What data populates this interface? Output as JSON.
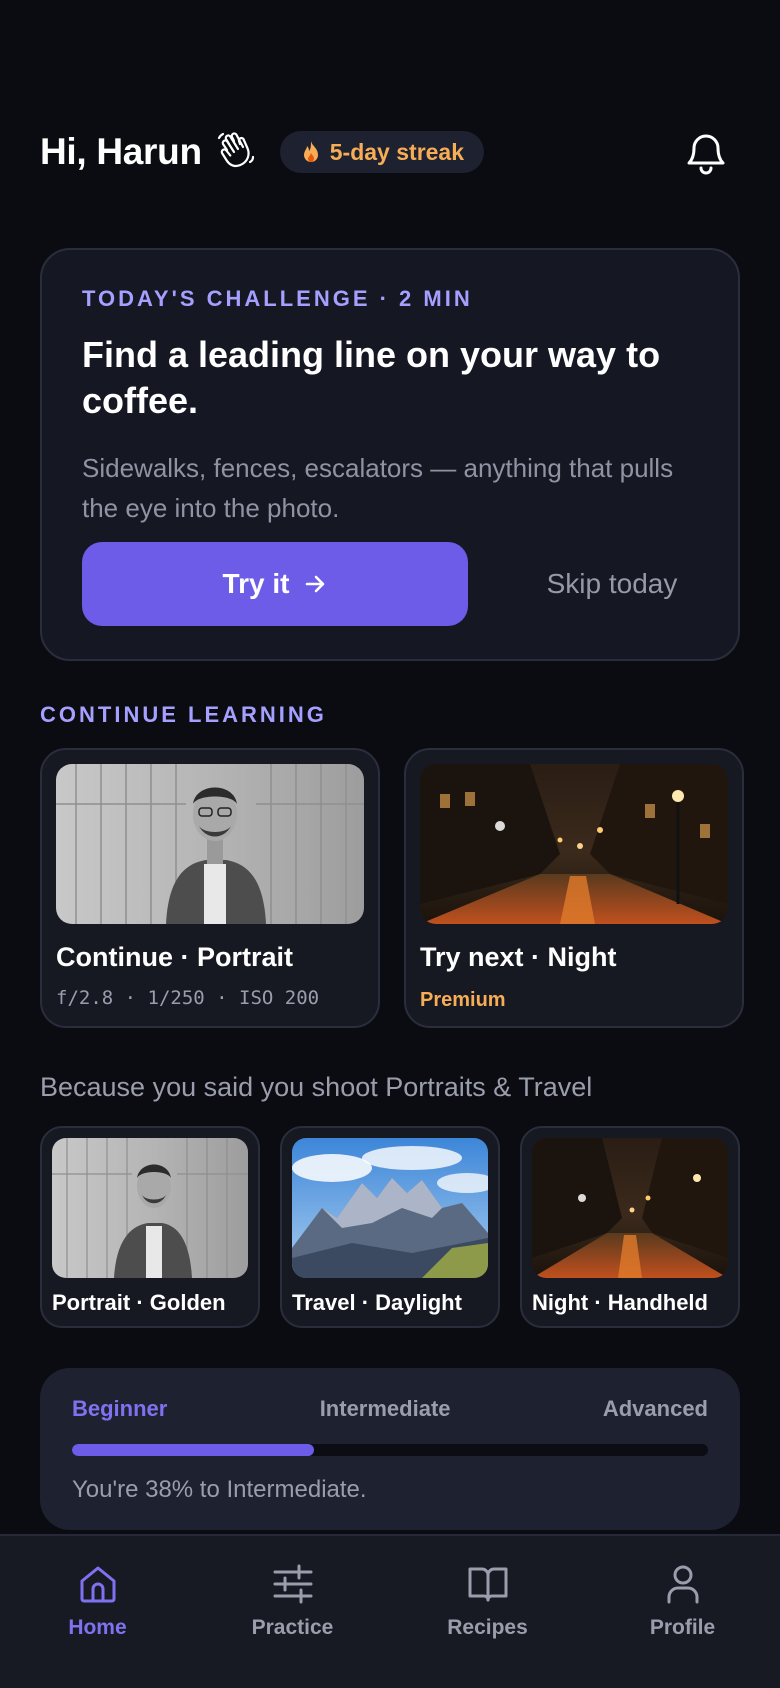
{
  "header": {
    "greeting": "Hi, Harun",
    "wave_icon": "waving-hand-icon",
    "streak": "5-day streak",
    "notification_icon": "bell-icon"
  },
  "challenge": {
    "eyebrow": "TODAY'S CHALLENGE · 2 MIN",
    "title": "Find a leading line on your way to coffee.",
    "description": "Sidewalks, fences, escalators — anything that pulls the eye into the photo.",
    "primary_label": "Try it",
    "secondary_label": "Skip today"
  },
  "continue_learning": {
    "title": "CONTINUE LEARNING",
    "cards": [
      {
        "title": "Continue · Portrait",
        "meta": "f/2.8 · 1/250 · ISO 200"
      },
      {
        "title": "Try next · Night",
        "badge": "Premium"
      }
    ]
  },
  "recommendations": {
    "title": "Because you said you shoot Portraits & Travel",
    "cards": [
      {
        "title": "Portrait · Golden"
      },
      {
        "title": "Travel · Daylight"
      },
      {
        "title": "Night · Handheld"
      }
    ]
  },
  "level": {
    "tabs": [
      "Beginner",
      "Intermediate",
      "Advanced"
    ],
    "active_tab": "Beginner",
    "progress_percent": 38,
    "status": "You're 38% to Intermediate."
  },
  "nav": {
    "items": [
      {
        "label": "Home",
        "icon": "home-icon",
        "active": true
      },
      {
        "label": "Practice",
        "icon": "sliders-icon",
        "active": false
      },
      {
        "label": "Recipes",
        "icon": "book-icon",
        "active": false
      },
      {
        "label": "Profile",
        "icon": "user-icon",
        "active": false
      }
    ]
  },
  "colors": {
    "background": "#0b0c12",
    "accent": "#6c5ce7",
    "accent_text": "#a5a0ff",
    "streak": "#f6ad55"
  }
}
